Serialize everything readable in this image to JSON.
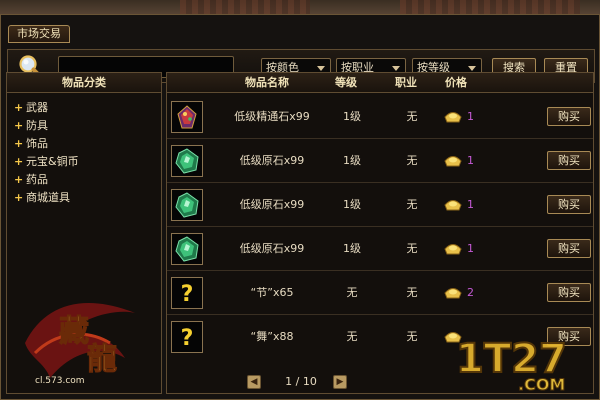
{
  "window": {
    "tab_label": "市场交易"
  },
  "toolbar": {
    "search_value": "",
    "filters": [
      {
        "label": "按颜色"
      },
      {
        "label": "按职业"
      },
      {
        "label": "按等级"
      }
    ],
    "search_button": "搜索",
    "reset_button": "重置"
  },
  "categories": {
    "header": "物品分类",
    "items": [
      {
        "label": "武器"
      },
      {
        "label": "防具"
      },
      {
        "label": "饰品"
      },
      {
        "label": "元宝&铜币"
      },
      {
        "label": "药品"
      },
      {
        "label": "商城道具"
      }
    ]
  },
  "logo": {
    "title": "藏龍",
    "site": "cl.573.com"
  },
  "table": {
    "columns": {
      "name": "物品名称",
      "level": "等级",
      "job": "职业",
      "price": "价格"
    },
    "rows": [
      {
        "icon": "gem-icon",
        "name": "低级精通石x99",
        "level": "1级",
        "job": "无",
        "price": "1",
        "buy": "购买"
      },
      {
        "icon": "green-stone-icon",
        "name": "低级原石x99",
        "level": "1级",
        "job": "无",
        "price": "1",
        "buy": "购买"
      },
      {
        "icon": "green-stone-icon",
        "name": "低级原石x99",
        "level": "1级",
        "job": "无",
        "price": "1",
        "buy": "购买"
      },
      {
        "icon": "green-stone-icon",
        "name": "低级原石x99",
        "level": "1级",
        "job": "无",
        "price": "1",
        "buy": "购买"
      },
      {
        "icon": "question-icon",
        "name": "“节”x65",
        "level": "无",
        "job": "无",
        "price": "2",
        "buy": "购买"
      },
      {
        "icon": "question-icon",
        "name": "“舞”x88",
        "level": "无",
        "job": "无",
        "price": "",
        "buy": "购买"
      }
    ]
  },
  "pager": {
    "text": "1 / 10"
  },
  "watermark": {
    "text": "1T27.COM"
  },
  "colors": {
    "accent": "#a88a55",
    "price": "#c55ad6",
    "plus": "#f5c84a"
  }
}
